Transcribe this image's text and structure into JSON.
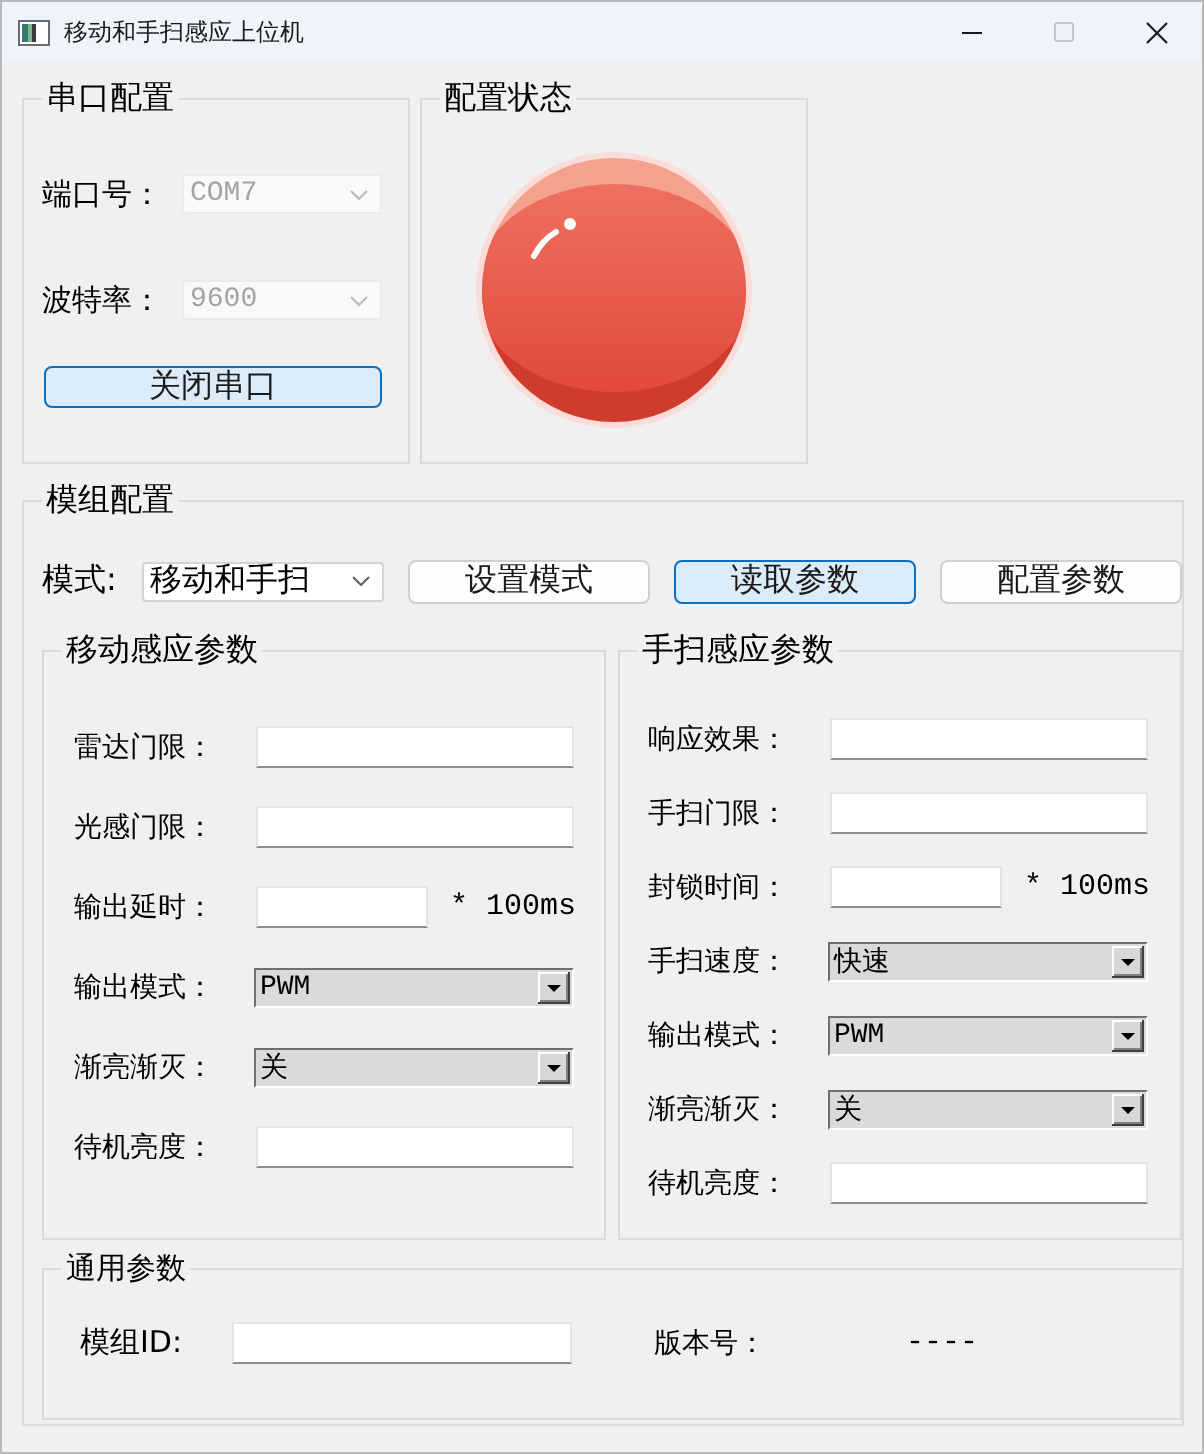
{
  "window": {
    "title": "移动和手扫感应上位机",
    "controls": [
      {
        "kind": "minimize",
        "disabled": false
      },
      {
        "kind": "maximize",
        "disabled": true
      },
      {
        "kind": "close",
        "disabled": false
      }
    ]
  },
  "serial": {
    "title": "串口配置",
    "fields": [
      {
        "label": "端口号：",
        "value": "COM7",
        "disabled": true
      },
      {
        "label": "波特率：",
        "value": "9600",
        "disabled": true
      }
    ],
    "button": {
      "label": "关闭串口",
      "focused": true
    }
  },
  "status": {
    "title": "配置状态",
    "lamp": {
      "configured": false
    }
  },
  "module": {
    "title": "模组配置",
    "mode": {
      "label": "模式:",
      "value": "移动和手扫"
    },
    "buttons": [
      {
        "label": "设置模式",
        "focused": false
      },
      {
        "label": "读取参数",
        "focused": true
      },
      {
        "label": "配置参数",
        "focused": false
      }
    ],
    "groups": [
      {
        "title": "移动感应参数",
        "rows": [
          {
            "kind": "input",
            "label": "雷达门限："
          },
          {
            "kind": "input",
            "label": "光感门限："
          },
          {
            "kind": "input_unit",
            "label": "输出延时：",
            "unit": "* 100ms"
          },
          {
            "kind": "select",
            "label": "输出模式：",
            "value": "PWM"
          },
          {
            "kind": "select",
            "label": "渐亮渐灭：",
            "value": "关"
          },
          {
            "kind": "input",
            "label": "待机亮度："
          }
        ]
      },
      {
        "title": "手扫感应参数",
        "rows": [
          {
            "kind": "input",
            "label": "响应效果："
          },
          {
            "kind": "input",
            "label": "手扫门限："
          },
          {
            "kind": "input_unit",
            "label": "封锁时间：",
            "unit": "* 100ms"
          },
          {
            "kind": "select",
            "label": "手扫速度：",
            "value": "快速"
          },
          {
            "kind": "select",
            "label": "输出模式：",
            "value": "PWM"
          },
          {
            "kind": "select",
            "label": "渐亮渐灭：",
            "value": "关"
          },
          {
            "kind": "input",
            "label": "待机亮度："
          }
        ]
      }
    ],
    "general": {
      "title": "通用参数",
      "fields": [
        {
          "kind": "input",
          "label": "模组ID:"
        },
        {
          "kind": "text",
          "label": "版本号：",
          "value": "----"
        }
      ]
    }
  }
}
